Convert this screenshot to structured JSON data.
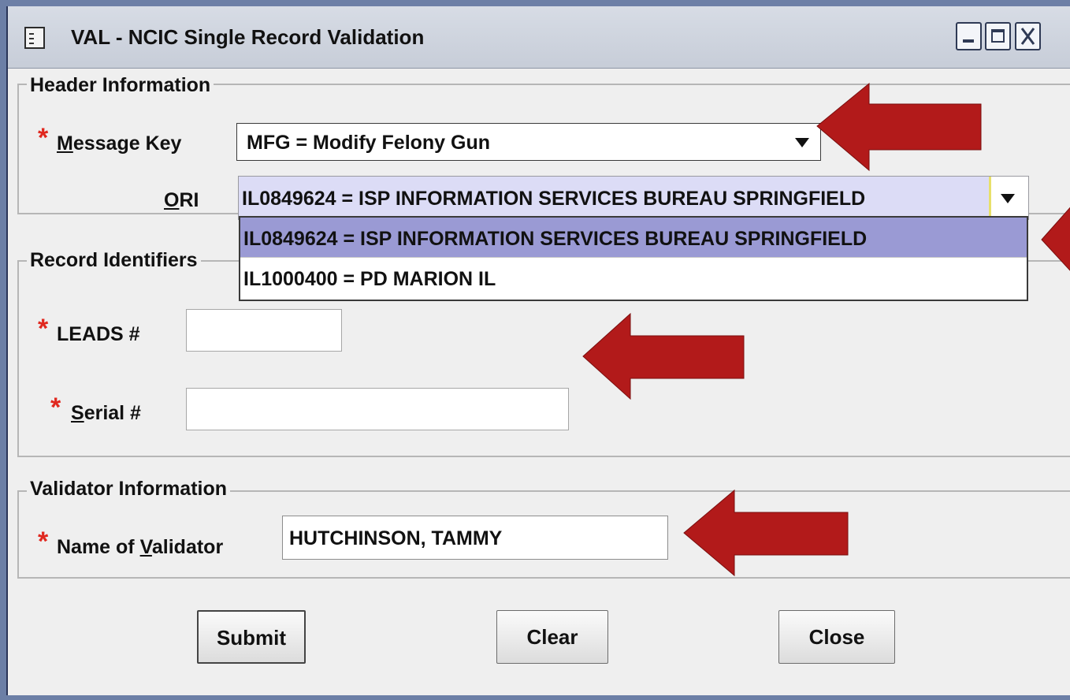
{
  "window": {
    "title": "VAL - NCIC Single Record Validation"
  },
  "header_section": {
    "legend": "Header Information",
    "message_key": {
      "label_prefix": "",
      "label_accel": "M",
      "label_rest": "essage Key",
      "value": "MFG = Modify Felony Gun"
    },
    "ori": {
      "label_accel": "O",
      "label_rest": "RI",
      "value": "IL0849624 = ISP INFORMATION SERVICES BUREAU SPRINGFIELD",
      "options": [
        "IL0849624 = ISP INFORMATION SERVICES BUREAU SPRINGFIELD",
        "IL1000400 = PD MARION IL"
      ]
    }
  },
  "record_section": {
    "legend": "Record Identifiers",
    "leads_label": "LEADS #",
    "leads_value": "",
    "serial": {
      "label_accel": "S",
      "label_rest": "erial #",
      "value": ""
    }
  },
  "validator_section": {
    "legend": "Validator Information",
    "name": {
      "label_pre": "Name of ",
      "label_accel": "V",
      "label_rest": "alidator",
      "value": "HUTCHINSON, TAMMY"
    }
  },
  "buttons": {
    "submit": "Submit",
    "clear": "Clear",
    "close": "Close"
  },
  "required_mark": "*",
  "colors": {
    "required": "#e0281f",
    "annotation_arrow": "#b21a1a",
    "selected_option": "#9a9ad4"
  }
}
